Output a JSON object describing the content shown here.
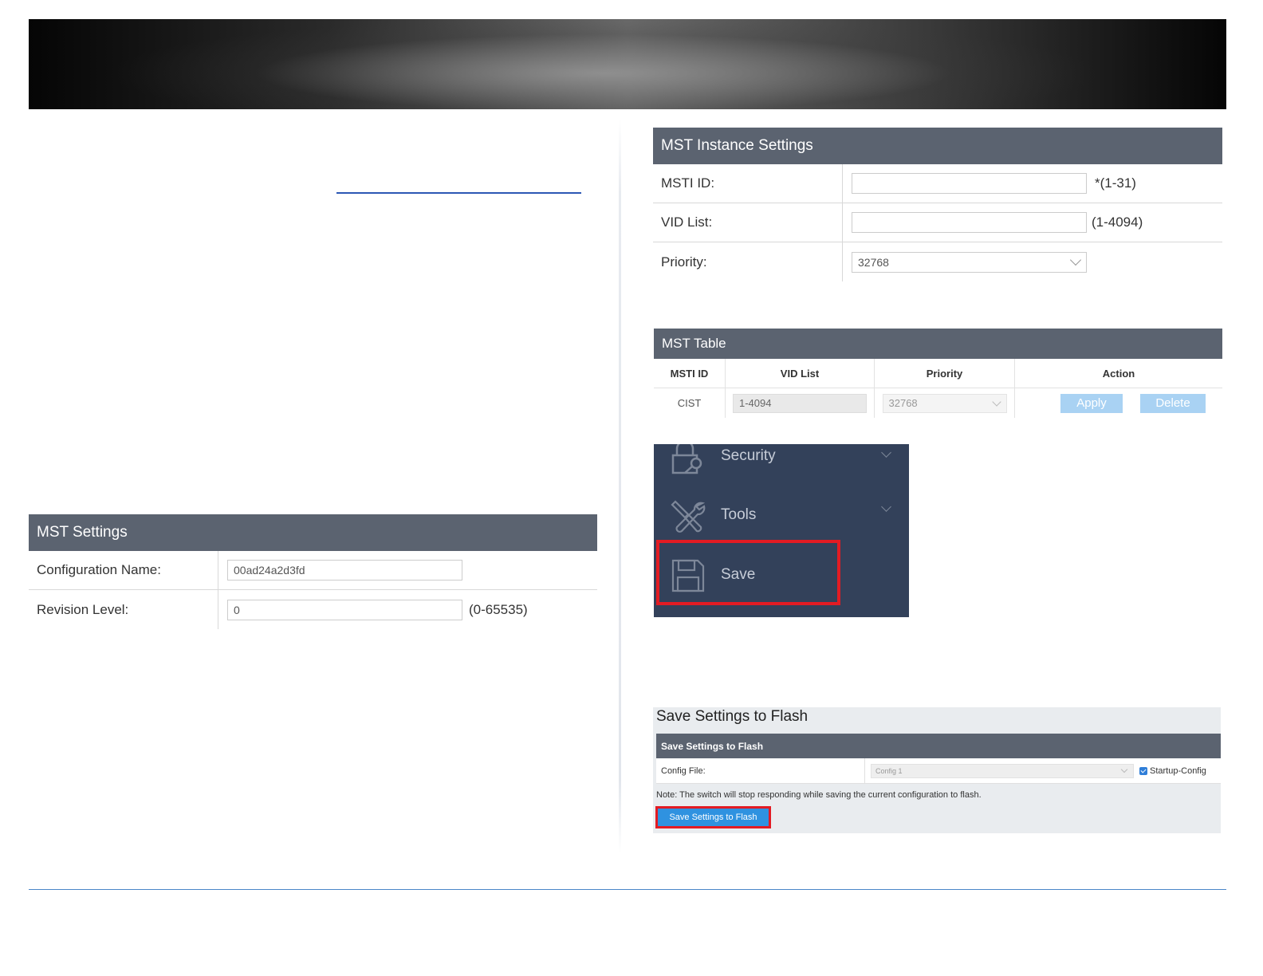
{
  "mst_settings": {
    "title": "MST Settings",
    "config_name_label": "Configuration Name:",
    "config_name_value": "00ad24a2d3fd",
    "revision_label": "Revision Level:",
    "revision_value": "0",
    "revision_hint": "(0-65535)"
  },
  "mst_instance": {
    "title": "MST Instance Settings",
    "msti_label": "MSTI ID:",
    "msti_value": "",
    "msti_hint": "*(1-31)",
    "vid_label": "VID List:",
    "vid_value": "",
    "vid_hint": "(1-4094)",
    "priority_label": "Priority:",
    "priority_value": "32768"
  },
  "mst_table": {
    "title": "MST Table",
    "columns": [
      "MSTI ID",
      "VID List",
      "Priority",
      "Action"
    ],
    "rows": [
      {
        "msti": "CIST",
        "vid": "1-4094",
        "priority": "32768",
        "apply": "Apply",
        "delete": "Delete"
      }
    ]
  },
  "nav_menu": {
    "items": [
      {
        "label": "Security",
        "icon": "lock-icon"
      },
      {
        "label": "Tools",
        "icon": "tools-icon"
      },
      {
        "label": "Save",
        "icon": "floppy-disk-icon"
      }
    ]
  },
  "flash": {
    "title": "Save Settings to Flash",
    "header": "Save Settings to Flash",
    "config_label": "Config File:",
    "config_value": "Config 1",
    "startup_label": "Startup-Config",
    "startup_checked": true,
    "note": "Note: The switch will stop responding while saving the current configuration to flash.",
    "button": "Save Settings to Flash"
  },
  "colors": {
    "panel_header": "#5b6370",
    "nav_bg": "#33415a",
    "highlight_red": "#e31b23",
    "primary_blue": "#2f92e0",
    "disabled_blue": "#a9d2f3"
  }
}
